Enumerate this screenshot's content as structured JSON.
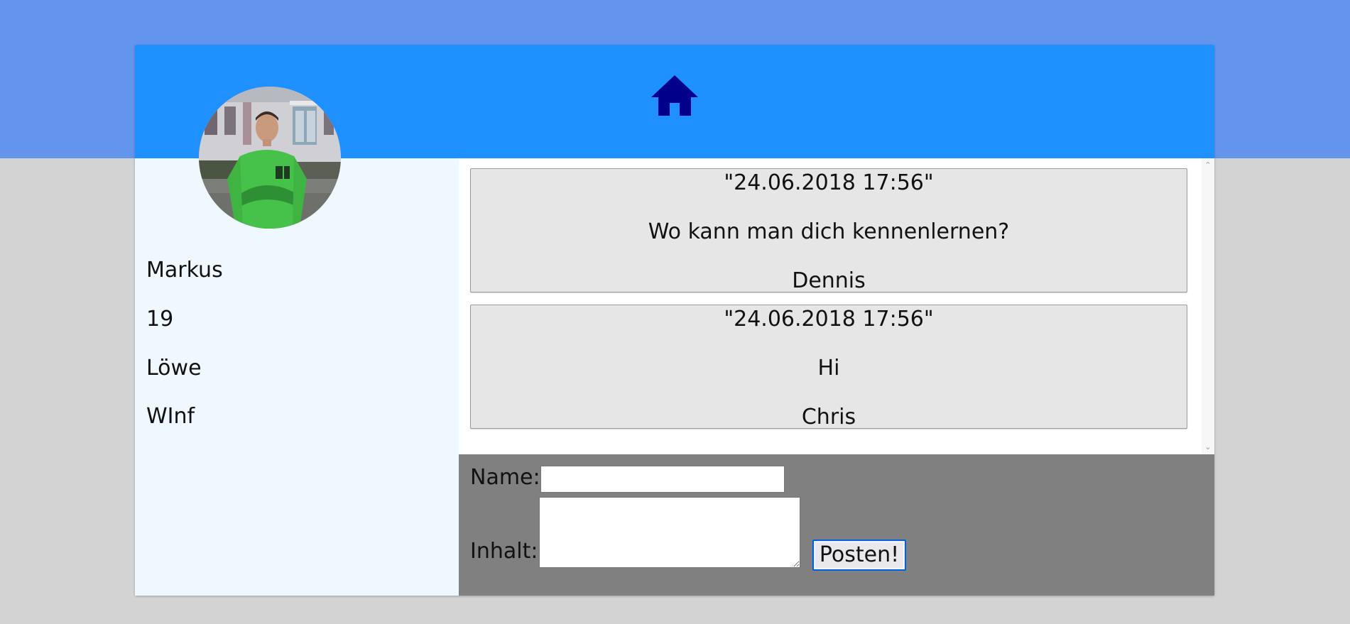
{
  "colors": {
    "top_band": "#6495ed",
    "page_background": "#d3d3d3",
    "header": "#1e90ff",
    "home_icon": "#00008b",
    "sidebar": "#f0f8ff",
    "post_card": "#e6e6e6",
    "form_area": "#808080"
  },
  "header": {
    "home_icon": "home-icon"
  },
  "profile": {
    "avatar": "avatar-photo",
    "name": "Markus",
    "age": "19",
    "zodiac": "Löwe",
    "course": "WInf"
  },
  "posts": [
    {
      "timestamp": "\"24.06.2018 17:56\"",
      "content": "Wo kann man dich kennenlernen?",
      "author": "Dennis"
    },
    {
      "timestamp": "\"24.06.2018 17:56\"",
      "content": "Hi",
      "author": "Chris"
    }
  ],
  "form": {
    "name_label": "Name:",
    "name_value": "",
    "content_label": "Inhalt:",
    "content_value": "",
    "submit_label": "Posten!"
  }
}
